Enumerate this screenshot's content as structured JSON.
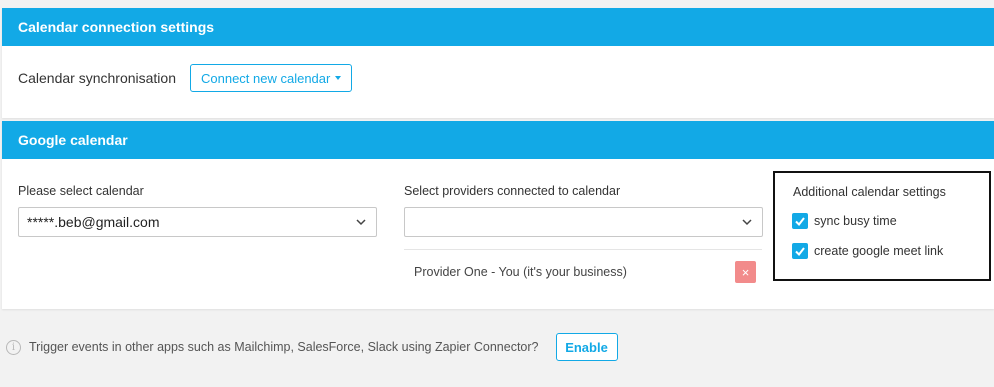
{
  "connection_panel": {
    "title": "Calendar connection settings",
    "sync_label": "Calendar synchronisation",
    "connect_button": "Connect new calendar"
  },
  "google_panel": {
    "title": "Google calendar",
    "calendar_select": {
      "label": "Please select calendar",
      "value": "*****.beb@gmail.com"
    },
    "providers_select": {
      "label": "Select providers connected to calendar",
      "value": ""
    },
    "providers": [
      {
        "name": "Provider One - You (it's your business)",
        "remove_icon": "×"
      }
    ],
    "additional_settings": {
      "title": "Additional calendar settings",
      "options": [
        {
          "label": "sync busy time",
          "checked": true
        },
        {
          "label": "create google meet link",
          "checked": true
        }
      ]
    }
  },
  "footer": {
    "info_icon": "i",
    "text": "Trigger events in other apps such as Mailchimp, SalesForce, Slack using Zapier Connector?",
    "enable_button": "Enable"
  },
  "colors": {
    "accent": "#12a9e6",
    "remove": "#f28b8b",
    "background": "#f2f2f2"
  }
}
